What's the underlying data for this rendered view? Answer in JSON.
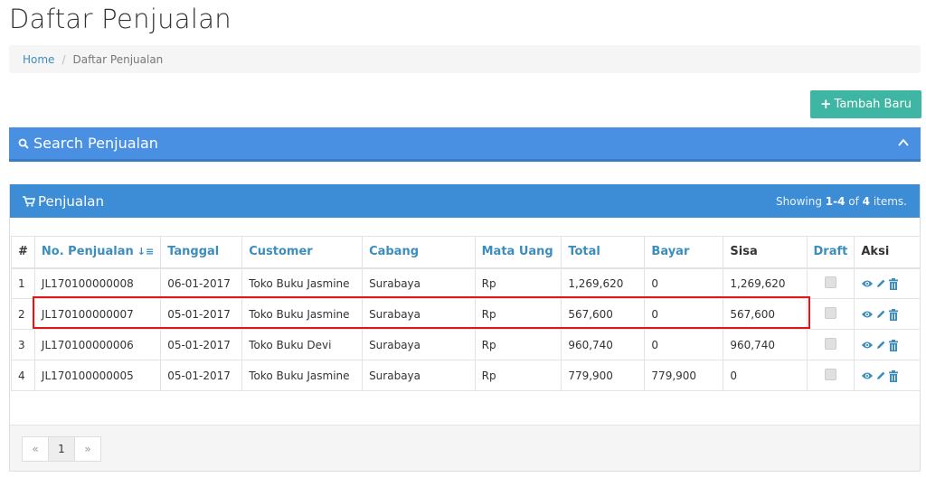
{
  "page": {
    "title": "Daftar Penjualan"
  },
  "breadcrumb": {
    "home": "Home",
    "separator": "/",
    "current": "Daftar Penjualan"
  },
  "toolbar": {
    "add_label": "Tambah Baru",
    "add_icon": "plus-icon"
  },
  "search_panel": {
    "title": "Search Penjualan",
    "icon": "search-icon",
    "toggle_icon": "chevron-up-icon"
  },
  "table_panel": {
    "title": "Penjualan",
    "icon": "cart-icon",
    "summary_prefix": "Showing ",
    "summary_range": "1-4",
    "summary_mid": " of ",
    "summary_total": "4",
    "summary_suffix": " items."
  },
  "table": {
    "headers": [
      "#",
      "No. Penjualan",
      "Tanggal",
      "Customer",
      "Cabang",
      "Mata Uang",
      "Total",
      "Bayar",
      "Sisa",
      "Draft",
      "Aksi"
    ],
    "rows": [
      {
        "num": "1",
        "no": "JL170100000008",
        "tanggal": "06-01-2017",
        "customer": "Toko Buku Jasmine",
        "cabang": "Surabaya",
        "mata_uang": "Rp",
        "total": "1,269,620",
        "bayar": "0",
        "sisa": "1,269,620"
      },
      {
        "num": "2",
        "no": "JL170100000007",
        "tanggal": "05-01-2017",
        "customer": "Toko Buku Jasmine",
        "cabang": "Surabaya",
        "mata_uang": "Rp",
        "total": "567,600",
        "bayar": "0",
        "sisa": "567,600"
      },
      {
        "num": "3",
        "no": "JL170100000006",
        "tanggal": "05-01-2017",
        "customer": "Toko Buku Devi",
        "cabang": "Surabaya",
        "mata_uang": "Rp",
        "total": "960,740",
        "bayar": "0",
        "sisa": "960,740"
      },
      {
        "num": "4",
        "no": "JL170100000005",
        "tanggal": "05-01-2017",
        "customer": "Toko Buku Jasmine",
        "cabang": "Surabaya",
        "mata_uang": "Rp",
        "total": "779,900",
        "bayar": "779,900",
        "sisa": "0"
      }
    ]
  },
  "pagination": {
    "prev": "«",
    "page": "1",
    "next": "»"
  },
  "colors": {
    "accent_blue": "#3c8dbc",
    "teal_button": "#3fb5a3",
    "search_panel": "#4a90e2",
    "table_header": "#3c8dd6",
    "highlight_red": "#e0161b"
  }
}
